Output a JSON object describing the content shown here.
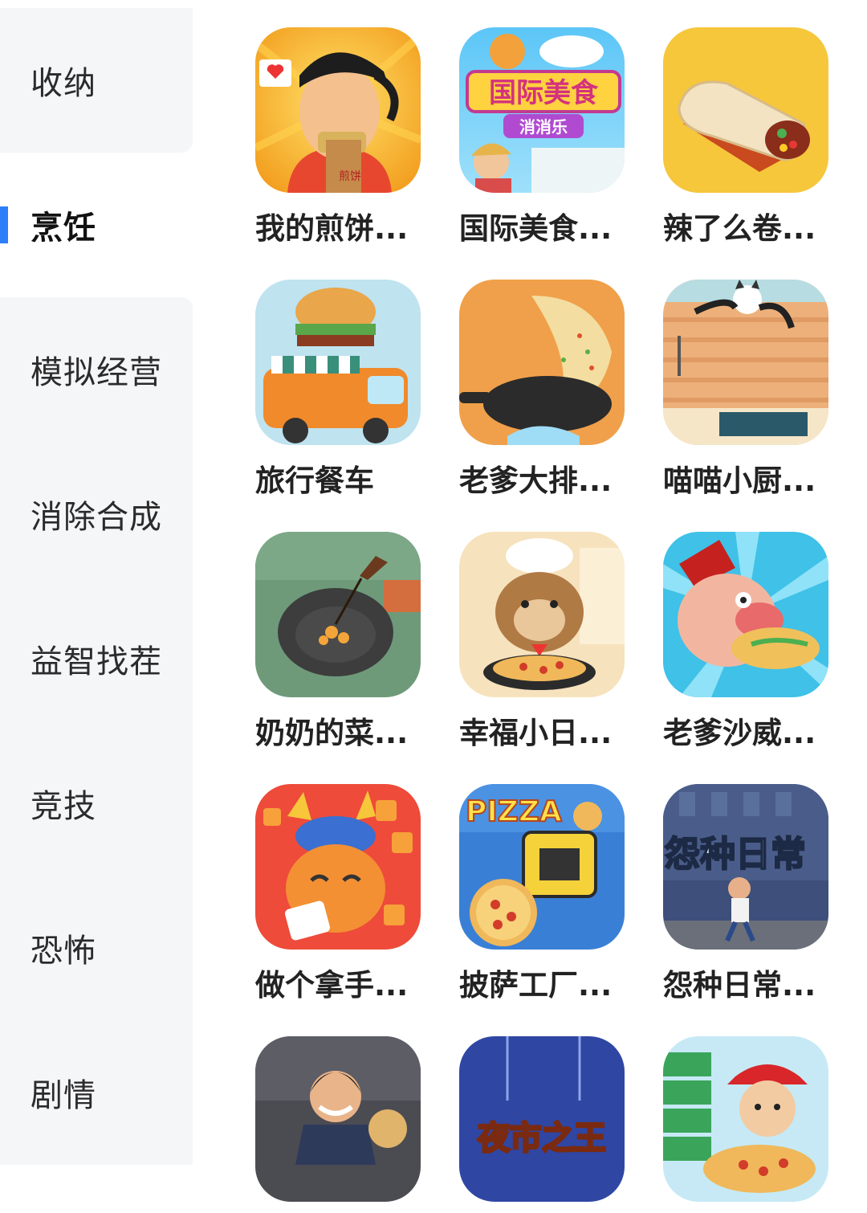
{
  "sidebar": {
    "items": [
      {
        "label": "收纳"
      },
      {
        "label": "烹饪"
      },
      {
        "label": "模拟经营"
      },
      {
        "label": "消除合成"
      },
      {
        "label": "益智找茬"
      },
      {
        "label": "竞技"
      },
      {
        "label": "恐怖"
      },
      {
        "label": "剧情"
      }
    ],
    "active_index": 1
  },
  "games": [
    {
      "name": "我的煎饼...",
      "icon": "pancake-man-icon",
      "icon_text": "煎饼"
    },
    {
      "name": "国际美食...",
      "icon": "international-food-icon",
      "title_line1": "国际美食",
      "title_line2": "消消乐"
    },
    {
      "name": "辣了么卷...",
      "icon": "burrito-icon"
    },
    {
      "name": "旅行餐车",
      "icon": "food-truck-icon"
    },
    {
      "name": "老爹大排...",
      "icon": "wok-fried-rice-icon"
    },
    {
      "name": "喵喵小厨...",
      "icon": "cat-kitchen-icon"
    },
    {
      "name": "奶奶的菜...",
      "icon": "grandma-wok-icon"
    },
    {
      "name": "幸福小日...",
      "icon": "beaver-chef-pizza-icon"
    },
    {
      "name": "老爹沙威...",
      "icon": "shawarma-man-icon"
    },
    {
      "name": "做个拿手...",
      "icon": "lobster-dragon-icon"
    },
    {
      "name": "披萨工厂...",
      "icon": "pizza-factory-icon",
      "title_text": "PIZZA"
    },
    {
      "name": "怨种日常...",
      "icon": "unlucky-daily-icon",
      "title_text": "怨种日常"
    },
    {
      "name": "",
      "icon": "bbq-man-icon"
    },
    {
      "name": "",
      "icon": "night-market-king-icon",
      "title_text": "夜市之王"
    },
    {
      "name": "",
      "icon": "pizza-delivery-boy-icon"
    }
  ],
  "colors": {
    "accent": "#2d7ff9",
    "sidebar_bg": "#f5f6f8"
  }
}
